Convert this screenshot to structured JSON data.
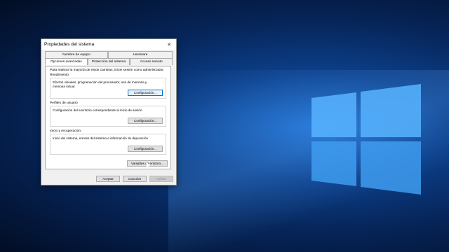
{
  "dialog": {
    "title": "Propiedades del sistema",
    "close_glyph": "✕",
    "tabs_top": [
      "Nombre de equipo",
      "Hardware"
    ],
    "tabs_bottom": [
      "Opciones avanzadas",
      "Protección del sistema",
      "Acceso remoto"
    ],
    "intro": "Para realizar la mayoría de estos cambios, inicie sesión como administrador.",
    "performance": {
      "title": "Rendimiento",
      "text": "Efectos visuales, programación del procesador, uso de memoria y memoria virtual",
      "button": "Configuración..."
    },
    "profiles": {
      "title": "Perfiles de usuario",
      "text": "Configuración del escritorio correspondiente al inicio de sesión",
      "button": "Configuración..."
    },
    "startup": {
      "title": "Inicio y recuperación",
      "text": "Inicio del sistema, errores del sistema e información de depuración",
      "button": "Configuración..."
    },
    "env_button": "Variables de entorno...",
    "ok": "Aceptar",
    "cancel": "Cancelar",
    "apply": "Aplicar"
  },
  "colors": {
    "desktop": "#0c3f8a",
    "accent": "#0078d7"
  }
}
